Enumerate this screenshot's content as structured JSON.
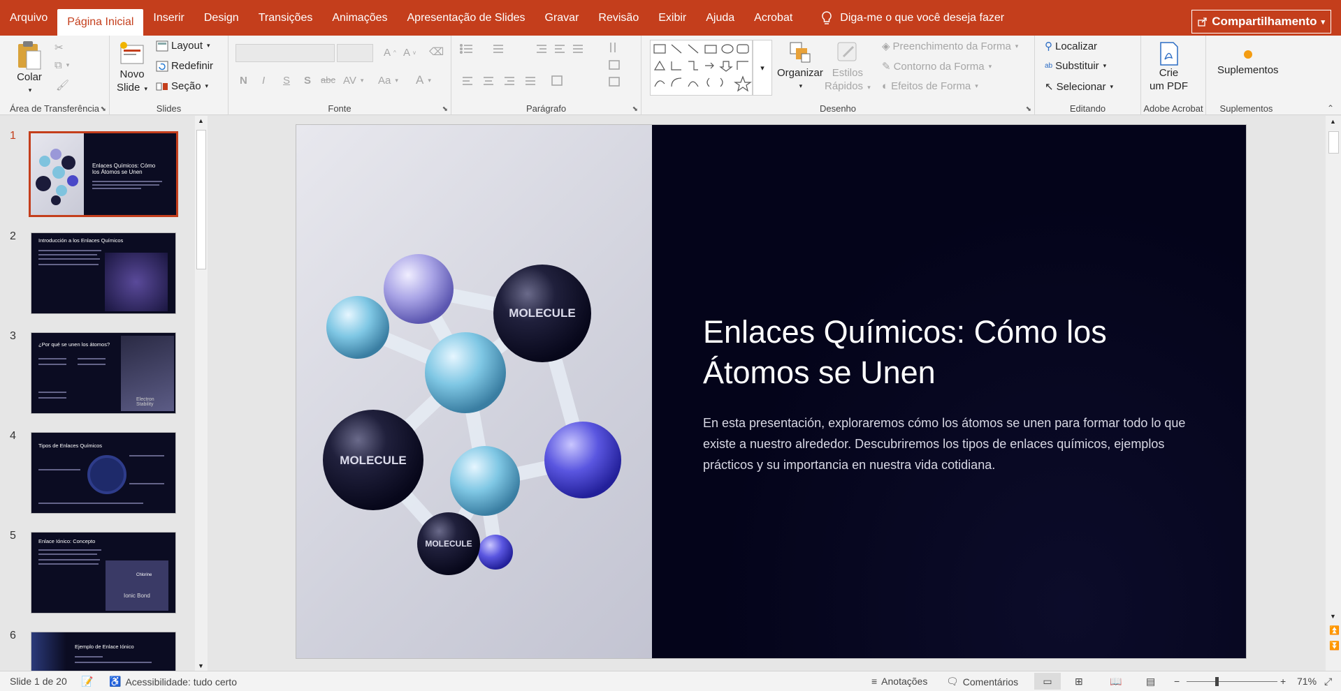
{
  "menu": {
    "tabs": [
      "Arquivo",
      "Página Inicial",
      "Inserir",
      "Design",
      "Transições",
      "Animações",
      "Apresentação de Slides",
      "Gravar",
      "Revisão",
      "Exibir",
      "Ajuda",
      "Acrobat"
    ],
    "active_index": 1,
    "tellme": "Diga-me o que você deseja fazer",
    "share": "Compartilhamento"
  },
  "ribbon": {
    "clipboard": {
      "label": "Área de Transferência",
      "paste": "Colar"
    },
    "slides": {
      "label": "Slides",
      "new_slide_1": "Novo",
      "new_slide_2": "Slide",
      "layout": "Layout",
      "reset": "Redefinir",
      "section": "Seção"
    },
    "font": {
      "label": "Fonte",
      "bold": "N",
      "italic": "I",
      "underline": "S",
      "shadow": "S",
      "strike": "abc",
      "spacing": "AV",
      "case": "Aa",
      "color": "A"
    },
    "paragraph": {
      "label": "Parágrafo"
    },
    "drawing": {
      "label": "Desenho",
      "arrange": "Organizar",
      "quick_styles_1": "Estilos",
      "quick_styles_2": "Rápidos",
      "fill": "Preenchimento da Forma",
      "outline": "Contorno da Forma",
      "effects": "Efeitos de Forma"
    },
    "editing": {
      "label": "Editando",
      "find": "Localizar",
      "replace": "Substituir",
      "select": "Selecionar"
    },
    "acrobat": {
      "label": "Adobe Acrobat",
      "create_1": "Crie",
      "create_2": "um PDF"
    },
    "addins": {
      "label": "Suplementos",
      "button": "Suplementos"
    }
  },
  "thumbnails": [
    {
      "num": "1",
      "title": "Enlaces Químicos: Cómo los Átomos se Unen"
    },
    {
      "num": "2",
      "title": "Introducción a los Enlaces Químicos"
    },
    {
      "num": "3",
      "title": "¿Por qué se unen los átomos?",
      "caption": "Electron Stability"
    },
    {
      "num": "4",
      "title": "Tipos de Enlaces Químicos"
    },
    {
      "num": "5",
      "title": "Enlace Iónico: Concepto",
      "caption": "Ionic Bond",
      "badge": "Chlorine"
    },
    {
      "num": "6",
      "title": "Ejemplo de Enlace Iónico"
    }
  ],
  "slide": {
    "title": "Enlaces Químicos: Cómo los Átomos se Unen",
    "body": "En esta presentación, exploraremos cómo los átomos se unen para formar todo lo que existe a nuestro alrededor. Descubriremos los tipos de enlaces químicos, ejemplos prácticos y su importancia en nuestra vida cotidiana.",
    "molecule_labels": [
      "MOLECULE",
      "MOLECULE",
      "MOLECULE"
    ]
  },
  "status": {
    "slide_count": "Slide 1 de 20",
    "accessibility": "Acessibilidade: tudo certo",
    "notes": "Anotações",
    "comments": "Comentários",
    "zoom": "71%"
  },
  "colors": {
    "accent": "#c43e1c",
    "slide_bg": "#04041a"
  }
}
